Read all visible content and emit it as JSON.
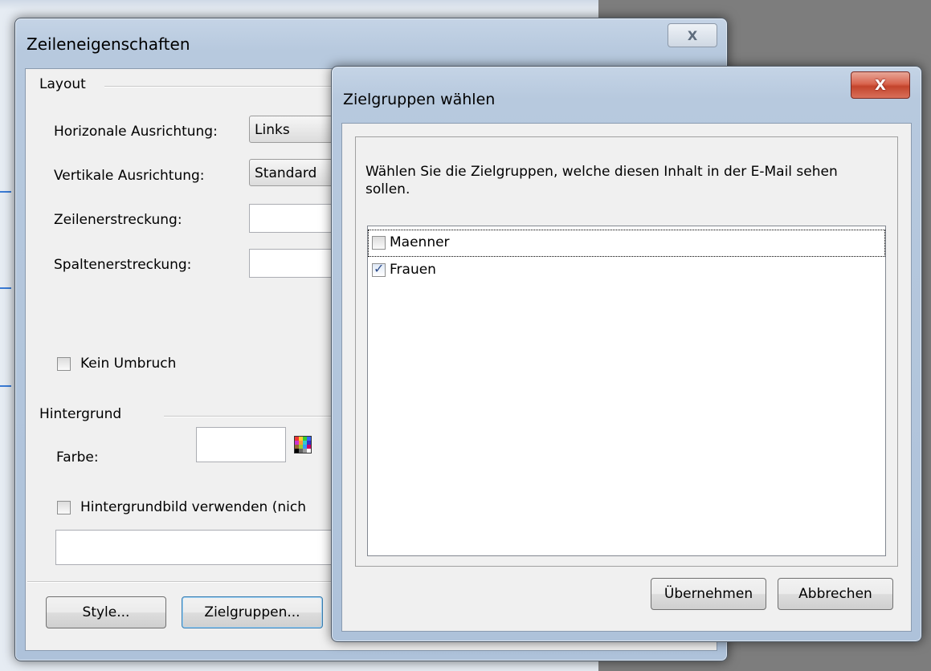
{
  "back_dialog": {
    "title": "Zeileneigenschaften",
    "close_label": "X",
    "layout_group": "Layout",
    "horizontal_label": "Horizonale Ausrichtung:",
    "horizontal_value": "Links",
    "vertical_label": "Vertikale Ausrichtung:",
    "vertical_value": "Standard",
    "rowspan_label": "Zeilenerstreckung:",
    "colspan_label": "Spaltenerstreckung:",
    "nowrap_label": "Kein Umbruch",
    "background_group": "Hintergrund",
    "color_label": "Farbe:",
    "bg_image_label": "Hintergrundbild verwenden (nich",
    "style_button": "Style...",
    "targetgroups_button": "Zielgruppen..."
  },
  "front_dialog": {
    "title": "Zielgruppen wählen",
    "close_label": "X",
    "instruction": "Wählen Sie die Zielgruppen, welche diesen Inhalt in der E-Mail sehen sollen.",
    "items": [
      {
        "label": "Maenner",
        "checked": false
      },
      {
        "label": "Frauen",
        "checked": true
      }
    ],
    "apply_button": "Übernehmen",
    "cancel_button": "Abbrechen"
  }
}
